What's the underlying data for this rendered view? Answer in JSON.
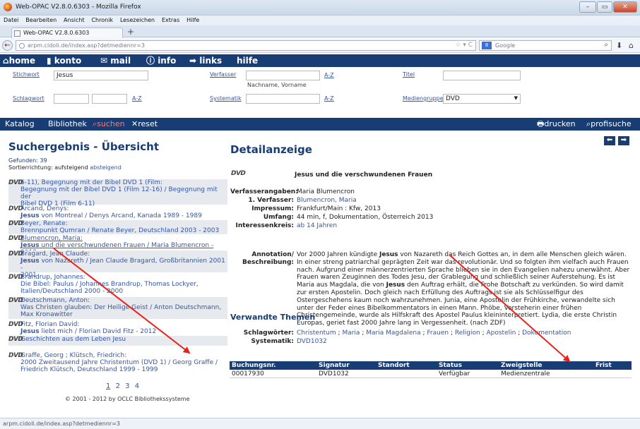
{
  "window": {
    "title": "Web-OPAC V2.8.0.6303 - Mozilla Firefox"
  },
  "menu": [
    "Datei",
    "Bearbeiten",
    "Ansicht",
    "Chronik",
    "Lesezeichen",
    "Extras",
    "Hilfe"
  ],
  "tab": {
    "title": "Web-OPAC V2.8.0.6303",
    "new_tab": "+"
  },
  "nav": {
    "url": "arpm.cidoli.de/index.asp?detmediennr=3",
    "search_placeholder": "Google",
    "search_engine": "8"
  },
  "sitenav": [
    "home",
    "konto",
    "mail",
    "info",
    "links",
    "hilfe"
  ],
  "form": {
    "stichwort_label": "Stichwort",
    "stichwort_value": "Jesus",
    "verfasser_label": "Verfasser",
    "verfasser_hint": "Nachname, Vorname",
    "titel_label": "Titel",
    "schlagwort_label": "Schlagwort",
    "systematik_label": "Systematik",
    "mediengruppe_label": "Mediengruppe",
    "mediengruppe_value": "DVD",
    "az": "A-Z"
  },
  "toolbar": {
    "katalog": "Katalog",
    "bibliothek": "Bibliothek",
    "suchen": "suchen",
    "reset": "reset",
    "drucken": "drucken",
    "profisuche": "profisuche"
  },
  "results": {
    "title": "Suchergebnis - Übersicht",
    "found_label": "Gefunden:",
    "found_count": "39",
    "sort_label": "Sortierrichtung: aufsteigend",
    "sort_link": "absteigend",
    "badge": "DVD",
    "items": [
      {
        "l1": "6-11), Begegnung mit der Bibel DVD 1 (Film:",
        "l2": "Begegnung mit der Bibel DVD 1 (Film 12-16) / Begegnung mit der",
        "l3": "Bibel DVD 1 (Film 6-11)"
      },
      {
        "l1": "Arcand, Denys:",
        "l2b": "Jesus",
        "l2": " von Montreal / Denys Arcand, Kanada 1989 - 1989"
      },
      {
        "l1": "Beyer, Renate:",
        "l2": "Brennpunkt Qumran / Renate Beyer, Deutschland 2003 - 2003"
      },
      {
        "l1": "Blumencron, Maria:",
        "l2b": "Jesus",
        "l2": " und die verschwundenen Frauen / Maria Blumencron - 2013"
      },
      {
        "l1": "Bragard, Jean Claude:",
        "l2b": "Jesus",
        "l2": " von Nazareth / Jean Claude Bragard, Großbritannien 2001 -",
        "l3": "2001"
      },
      {
        "l1": "Brandrup, Johannes:",
        "l2": "Die Bibel: Paulus / Johannes Brandrup, Thomas Lockyer,",
        "l3": "Italien/Deutschland 2000 - 2000"
      },
      {
        "l1": "Deutschmann, Anton:",
        "l2": "Was Christen glauben: Der Heilige Geist / Anton Deutschmann,",
        "l3": "Max Kronawitter"
      },
      {
        "l1": "Fitz, Florian David:",
        "l2b": "Jesus",
        "l2": " liebt mich / Florian David Fitz - 2012"
      },
      {
        "l1": "Geschichten aus dem Leben Jesu"
      },
      {
        "l1": "Graffe, Georg ; Klütsch, Friedrich:",
        "l2": "2000 Zweitausend Jahre Christentum (DVD 1) / Georg Graffe /",
        "l3": "Friedrich Klütsch, Deutschland 1999 - 1999"
      }
    ],
    "pages": [
      "1",
      "2",
      "3",
      "4"
    ],
    "copyright": "© 2001 - 2012 by OCLC Bibliothekssysteme"
  },
  "detail": {
    "title": "Detailanzeige",
    "media_title": "Jesus und die verschwundenen Frauen",
    "verfasserangaben_label": "Verfasserangaben:",
    "verfasserangaben": "Maria Blumencron",
    "verfasser1_label": "1. Verfasser:",
    "verfasser1": "Blumencron, Maria",
    "impressum_label": "Impressum:",
    "impressum": "Frankfurt/Main : Kfw, 2013",
    "umfang_label": "Umfang:",
    "umfang": "44 min, f, Dokumentation, Österreich 2013",
    "interessenkreis_label": "Interessenkreis:",
    "interessenkreis": "ab 14 Jahren",
    "annotation_label1": "Annotation/",
    "annotation_label2": "Beschreibung:",
    "annotation": [
      "Vor 2000 Jahren kündigte ",
      "Jesus",
      " von Nazareth das Reich Gottes an, in dem alle Menschen gleich wären. In einer streng patriarchal geprägten Zeit war das revolutionär. Und so folgten ihm vielfach auch Frauen nach. Aufgrund einer männerzentrierten Sprache blieben sie in den Evangelien nahezu unerwähnt. Aber Frauen waren Zeuginnen des Todes Jesu, der Grablegung und schließlich seiner Auferstehung. Es ist Maria aus Magdala, die von ",
      "Jesus",
      " den Auftrag erhält, die Frohe Botschaft zu verkünden. So wird damit zur ersten Apostelin. Doch gleich nach Erfüllung des Auftrags ist sie als Schlüsselfigur des Ostergeschehens kaum noch wahrzunehmen. Junia, eine Apostelin der Frühkirche, verwandelte sich unter der Feder eines Bibelkommentators in einen Mann. Phöbe, Vorsteherin einer frühen Christengemeinde, wurde als Hilfskraft des Apostel Paulus kleininterpretiert. Lydia, die erste Christin Europas, geriet fast 2000 Jahre lang in Vergessenheit. (nach ZDF)"
    ],
    "verwandte_title": "Verwandte Themen",
    "schlagwoerter_label": "Schlagwörter:",
    "schlagwoerter": [
      "Christentum",
      "Maria",
      "Maria Magdalena",
      "Frauen",
      "Religion",
      "Apostelin",
      "Dokumentation"
    ],
    "systematik_label": "Systematik:",
    "systematik": "DVD1032"
  },
  "table": {
    "headers": [
      "Buchungsnr.",
      "Signatur",
      "Standort",
      "Status",
      "Zweigstelle",
      "Frist"
    ],
    "row": [
      "00017930",
      "DVD1032",
      "",
      "Verfügbar",
      "Medienzentrale",
      ""
    ]
  },
  "statusbar": "arpm.cidoli.de/index.asp?detmediennr=3",
  "colors": {
    "nav_blue": "#173d74",
    "link": "#3355aa",
    "arrow": "#e8221c"
  }
}
